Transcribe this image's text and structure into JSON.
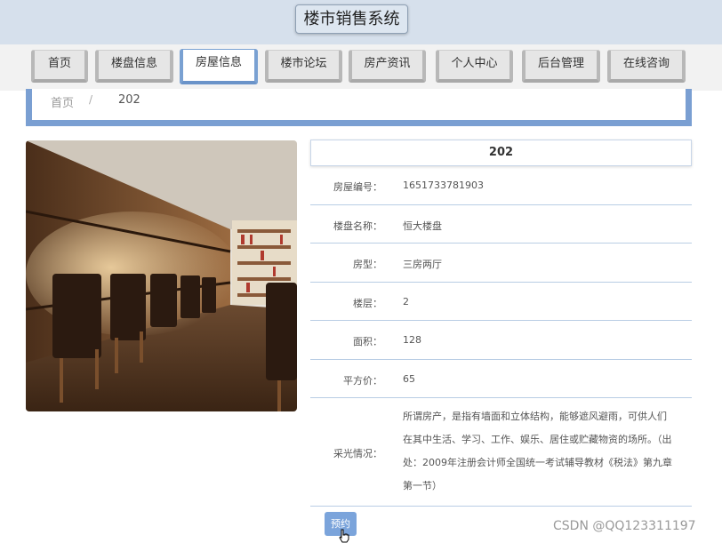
{
  "header": {
    "title": "楼市销售系统"
  },
  "nav": {
    "items": [
      {
        "label": "首页"
      },
      {
        "label": "楼盘信息"
      },
      {
        "label": "房屋信息"
      },
      {
        "label": "楼市论坛"
      },
      {
        "label": "房产资讯"
      },
      {
        "label": "个人中心"
      },
      {
        "label": "后台管理"
      },
      {
        "label": "在线咨询"
      }
    ],
    "active_index": 2
  },
  "breadcrumb": {
    "home": "首页",
    "separator": "/",
    "current": "202"
  },
  "detail": {
    "title": "202",
    "fields": [
      {
        "label": "房屋编号：",
        "value": "1651733781903"
      },
      {
        "label": "楼盘名称：",
        "value": "恒大楼盘"
      },
      {
        "label": "房型：",
        "value": "三房两厅"
      },
      {
        "label": "楼层：",
        "value": "2"
      },
      {
        "label": "面积：",
        "value": "128"
      },
      {
        "label": "平方价：",
        "value": "65"
      },
      {
        "label": "采光情况：",
        "value": "所谓房产，是指有墙面和立体结构，能够遮风避雨，可供人们在其中生活、学习、工作、娱乐、居住或贮藏物资的场所。（出处：2009年注册会计师全国统一考试辅导教材《税法》第九章第一节）"
      }
    ],
    "reserve_label": "预约"
  },
  "watermark": "CSDN @QQ123311197",
  "colors": {
    "accent": "#7a9fd2",
    "header_bg": "#d6e0ec"
  }
}
